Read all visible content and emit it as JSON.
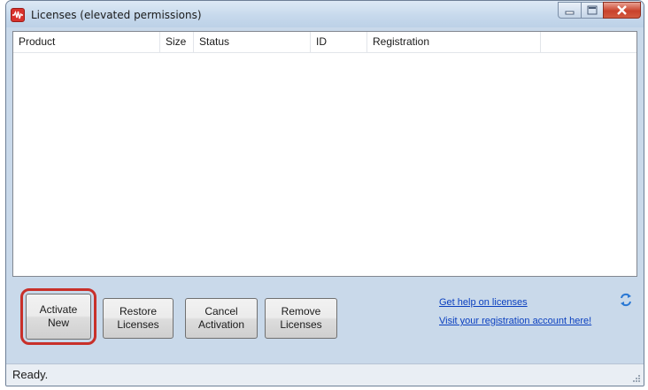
{
  "window": {
    "title": "Licenses (elevated permissions)",
    "controls": {
      "minimize": "minimize-icon",
      "maximize": "maximize-icon",
      "close": "close-icon"
    },
    "close_color": "#c9422c"
  },
  "table": {
    "columns": [
      "Product",
      "Size",
      "Status",
      "ID",
      "Registration"
    ],
    "rows": []
  },
  "buttons": {
    "activate_new": "Activate\nNew",
    "restore_licenses": "Restore\nLicenses",
    "cancel_activation": "Cancel\nActivation",
    "remove_licenses": "Remove\nLicenses"
  },
  "links": {
    "help": "Get help on licenses",
    "registration": "Visit your registration account here!"
  },
  "status": {
    "text": "Ready."
  },
  "highlight_color": "#c8302a",
  "icons": {
    "app": "app-icon",
    "refresh": "refresh-icon",
    "grip": "resize-grip-icon"
  }
}
